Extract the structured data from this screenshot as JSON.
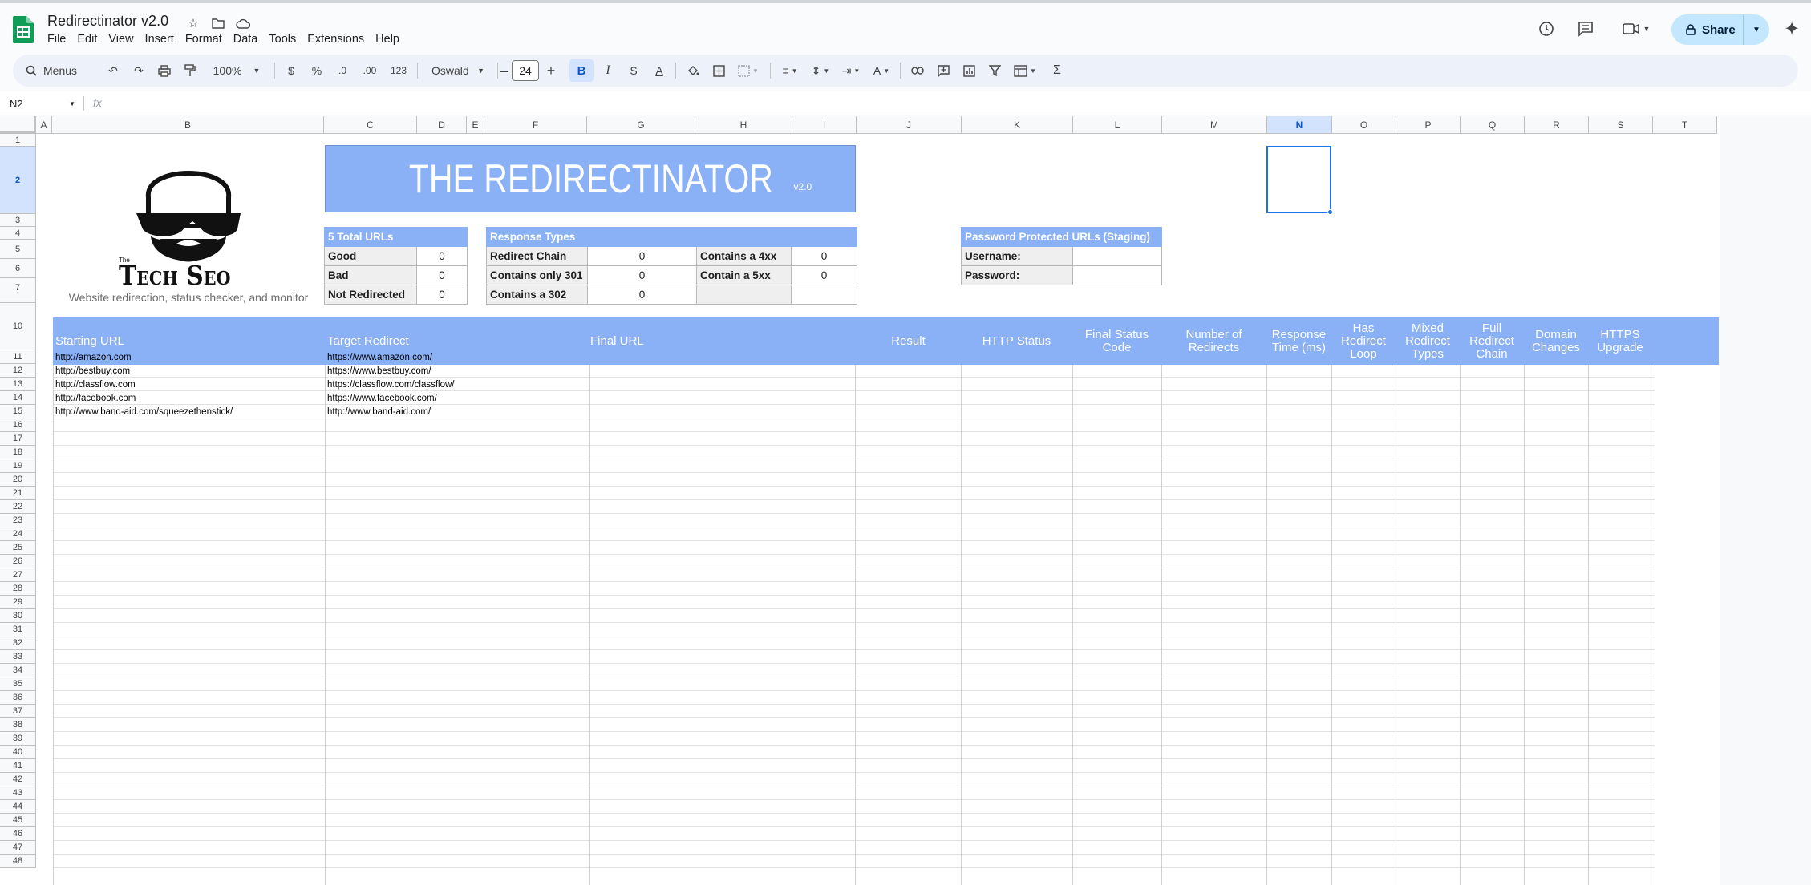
{
  "doc": {
    "title": "Redirectinator v2.0"
  },
  "menu": [
    "File",
    "Edit",
    "View",
    "Insert",
    "Format",
    "Data",
    "Tools",
    "Extensions",
    "Help"
  ],
  "share": {
    "label": "Share"
  },
  "toolbar": {
    "search_label": "Menus",
    "zoom": "100%",
    "currency": "$",
    "percent": "%",
    "dec_decrease": ".0",
    "dec_increase": ".00",
    "number_format": "123",
    "font": "Oswald",
    "font_size": "24",
    "bold": "B",
    "italic": "I",
    "strike": "S",
    "text_color": "A",
    "sum": "Σ"
  },
  "formula": {
    "cell_ref": "N2",
    "fx": "fx",
    "value": ""
  },
  "columns": [
    "A",
    "B",
    "C",
    "D",
    "E",
    "F",
    "G",
    "H",
    "I",
    "J",
    "K",
    "L",
    "M",
    "N",
    "O",
    "P",
    "Q",
    "R",
    "S",
    "T"
  ],
  "selected_column": "N",
  "rows": [
    "1",
    "2",
    "3",
    "4",
    "5",
    "6",
    "7",
    "",
    "10",
    "11",
    "12",
    "13",
    "14",
    "15",
    "16",
    "17",
    "18",
    "19",
    "20",
    "21",
    "22",
    "23",
    "24",
    "25",
    "26",
    "27",
    "28",
    "29",
    "30",
    "31",
    "32",
    "33",
    "34",
    "35",
    "36",
    "37",
    "38",
    "39",
    "40",
    "41",
    "42",
    "43",
    "44",
    "45",
    "46",
    "47",
    "48"
  ],
  "selected_row": "2",
  "banner": {
    "title": "THE REDIRECTINATOR",
    "version": "v2.0"
  },
  "logo": {
    "wordmark_the": "The",
    "wordmark": "Tech Seo",
    "tagline": "Website redirection, status checker, and monitor"
  },
  "summary": {
    "header": "5 Total URLs",
    "rows": [
      {
        "label": "Good",
        "value": "0"
      },
      {
        "label": "Bad",
        "value": "0"
      },
      {
        "label": "Not Redirected",
        "value": "0"
      }
    ]
  },
  "response_types": {
    "header": "Response Types",
    "rows": [
      {
        "label": "Redirect Chain",
        "value": "0",
        "label2": "Contains a 4xx",
        "value2": "0"
      },
      {
        "label": "Contains only 301",
        "value": "0",
        "label2": "Contain a 5xx",
        "value2": "0"
      },
      {
        "label": "Contains a 302",
        "value": "0",
        "label2": "",
        "value2": ""
      }
    ]
  },
  "password": {
    "header": "Password Protected URLs (Staging)",
    "username_label": "Username:",
    "password_label": "Password:",
    "username": "",
    "password": ""
  },
  "table_headers": {
    "starting_url": "Starting URL",
    "target_redirect": "Target Redirect",
    "final_url": "Final URL",
    "result": "Result",
    "http_status": "HTTP Status",
    "final_status_code": "Final Status Code",
    "number_of_redirects": "Number of Redirects",
    "response_time_1": "Response",
    "response_time_2": "Time (ms)",
    "has_redirect_loop_1": "Has",
    "has_redirect_loop_2": "Redirect",
    "has_redirect_loop_3": "Loop",
    "mixed_redirect_types_1": "Mixed",
    "mixed_redirect_types_2": "Redirect",
    "mixed_redirect_types_3": "Types",
    "full_redirect_chain_1": "Full",
    "full_redirect_chain_2": "Redirect",
    "full_redirect_chain_3": "Chain",
    "domain_changes_1": "Domain",
    "domain_changes_2": "Changes",
    "https_upgrade_1": "HTTPS",
    "https_upgrade_2": "Upgrade"
  },
  "urls": [
    {
      "start": "http://amazon.com",
      "target": "https://www.amazon.com/"
    },
    {
      "start": "http://bestbuy.com",
      "target": "https://www.bestbuy.com/"
    },
    {
      "start": "http://classflow.com",
      "target": "https://classflow.com/classflow/"
    },
    {
      "start": "http://facebook.com",
      "target": "https://www.facebook.com/"
    },
    {
      "start": "http://www.band-aid.com/squeezethenstick/",
      "target": "http://www.band-aid.com/"
    }
  ]
}
